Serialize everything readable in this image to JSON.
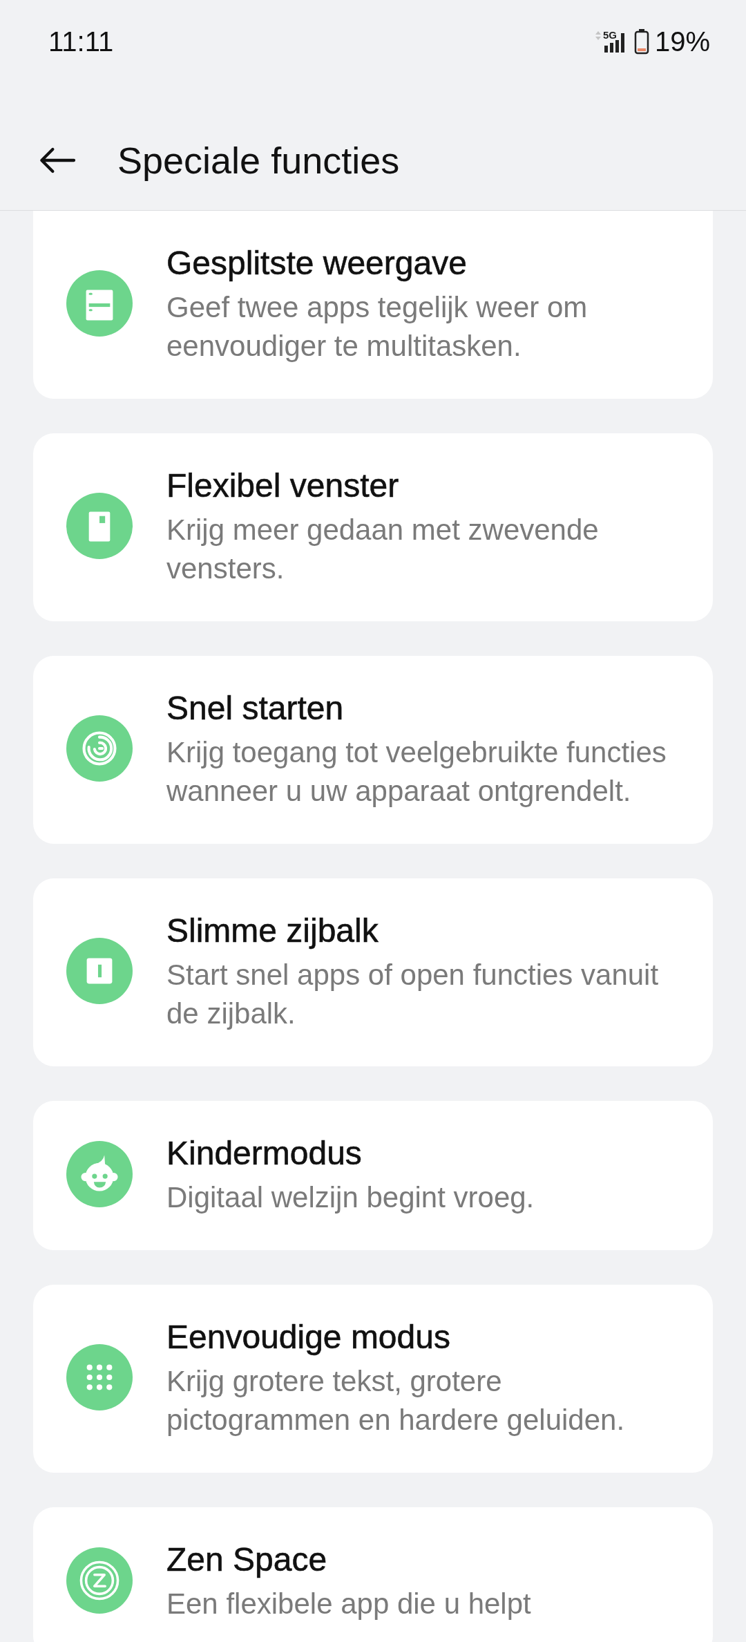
{
  "status_bar": {
    "time": "11:11",
    "network": "5G",
    "battery_percent": "19%"
  },
  "header": {
    "title": "Speciale functies"
  },
  "items": [
    {
      "title": "Gesplitste weergave",
      "description": "Geef twee apps tegelijk weer om eenvoudiger te multitasken."
    },
    {
      "title": "Flexibel venster",
      "description": "Krijg meer gedaan met zwevende vensters."
    },
    {
      "title": "Snel starten",
      "description": "Krijg toegang tot veelgebruikte functies wanneer u uw apparaat ontgrendelt."
    },
    {
      "title": "Slimme zijbalk",
      "description": "Start snel apps of open functies vanuit de zijbalk."
    },
    {
      "title": "Kindermodus",
      "description": "Digitaal welzijn begint vroeg."
    },
    {
      "title": "Eenvoudige modus",
      "description": "Krijg grotere tekst, grotere pictogrammen en hardere geluiden."
    },
    {
      "title": "Zen Space",
      "description": "Een flexibele app die u helpt"
    }
  ]
}
